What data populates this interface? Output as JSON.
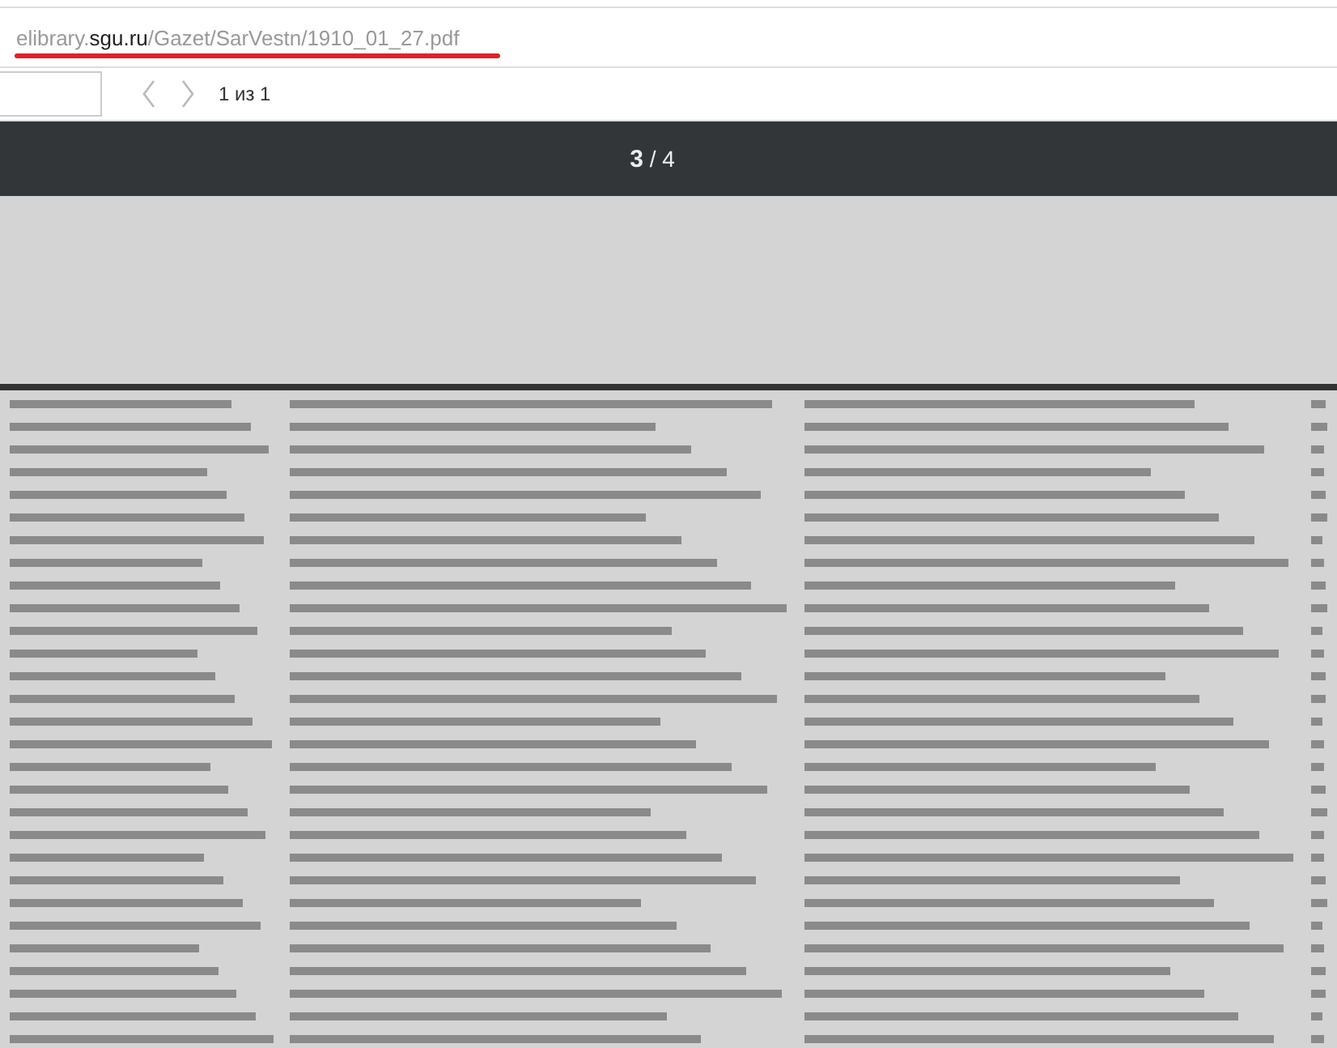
{
  "address_bar": {
    "url_host_prefix": "elibrary.",
    "url_domain": "sgu.ru",
    "url_path": "/Gazet/SarVestn/1910_01_27.pdf",
    "underlined": true
  },
  "find_bar": {
    "result": "1 из 1",
    "prev_disabled": true,
    "next_disabled": true
  },
  "pdf_toolbar": {
    "page": "3",
    "separator": "/",
    "total": "4"
  },
  "scan": {
    "kind": "scanned-page"
  }
}
